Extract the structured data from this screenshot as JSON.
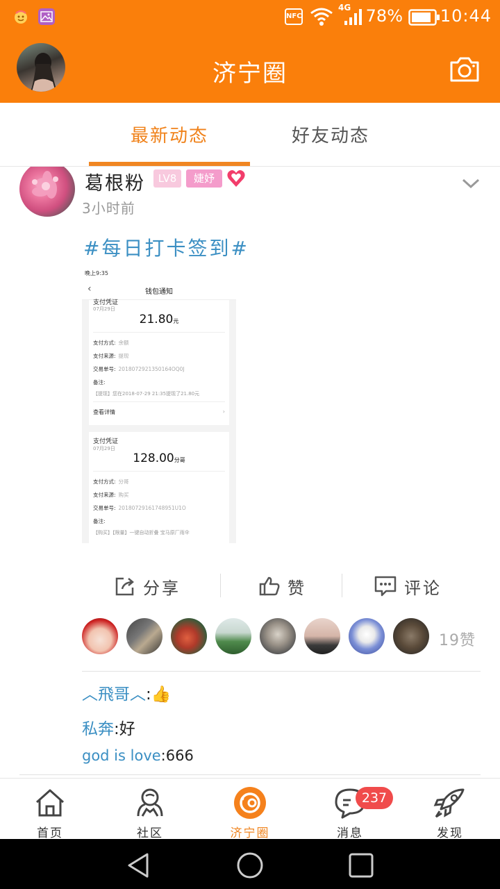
{
  "status_bar": {
    "nfc": "NFC",
    "network": "4G",
    "battery": "78%",
    "time": "10:44"
  },
  "app_bar": {
    "title": "济宁圈"
  },
  "tabs": [
    {
      "label": "最新动态",
      "active": true
    },
    {
      "label": "好友动态",
      "active": false
    }
  ],
  "post": {
    "author": "葛根粉",
    "level_badge": "LV8",
    "tag_badge": "婕妤",
    "time": "3小时前",
    "hashtag": "#每日打卡签到#",
    "screenshot": {
      "status_time": "晚上9:35",
      "title": "钱包通知",
      "cards": [
        {
          "title": "支付凭证",
          "date": "07月29日",
          "amount": "21.80",
          "unit": "元",
          "rows": [
            {
              "label": "支付方式:",
              "value": "余额"
            },
            {
              "label": "支付来源:",
              "value": "提现"
            },
            {
              "label": "交易单号:",
              "value": "2018072921350164OQ0J"
            },
            {
              "label": "备注:",
              "value": ""
            }
          ],
          "note": "【提现】您在2018-07-29 21:35提现了21.80元",
          "detail": "查看详情"
        },
        {
          "title": "支付凭证",
          "date": "07月29日",
          "amount": "128.00",
          "unit": "分哥",
          "rows": [
            {
              "label": "支付方式:",
              "value": "分哥"
            },
            {
              "label": "支付来源:",
              "value": "购买"
            },
            {
              "label": "交易单号:",
              "value": "20180729161748951U1O"
            },
            {
              "label": "备注:",
              "value": ""
            }
          ],
          "note": "【购买】【限量】一键自动折叠 宝马原厂雨伞"
        }
      ]
    },
    "actions": {
      "share": "分享",
      "like": "赞",
      "comment": "评论"
    },
    "likes_count": "19赞",
    "comments": [
      {
        "user": "︿飛哥︿",
        "sep": ":",
        "text": "👍"
      },
      {
        "user": "私奔",
        "sep": ":",
        "text": "好"
      },
      {
        "user": "god is love",
        "sep": ":",
        "text": "666"
      }
    ]
  },
  "bottom_nav": [
    {
      "label": "首页",
      "icon": "home-icon",
      "active": false
    },
    {
      "label": "社区",
      "icon": "community-icon",
      "active": false
    },
    {
      "label": "济宁圈",
      "icon": "circle-icon",
      "active": true
    },
    {
      "label": "消息",
      "icon": "message-icon",
      "active": false,
      "badge": "237"
    },
    {
      "label": "发现",
      "icon": "rocket-icon",
      "active": false
    }
  ],
  "colors": {
    "brand_orange": "#fa7f0b",
    "link_blue": "#3b8fc3",
    "badge_red": "#f04b4b"
  }
}
